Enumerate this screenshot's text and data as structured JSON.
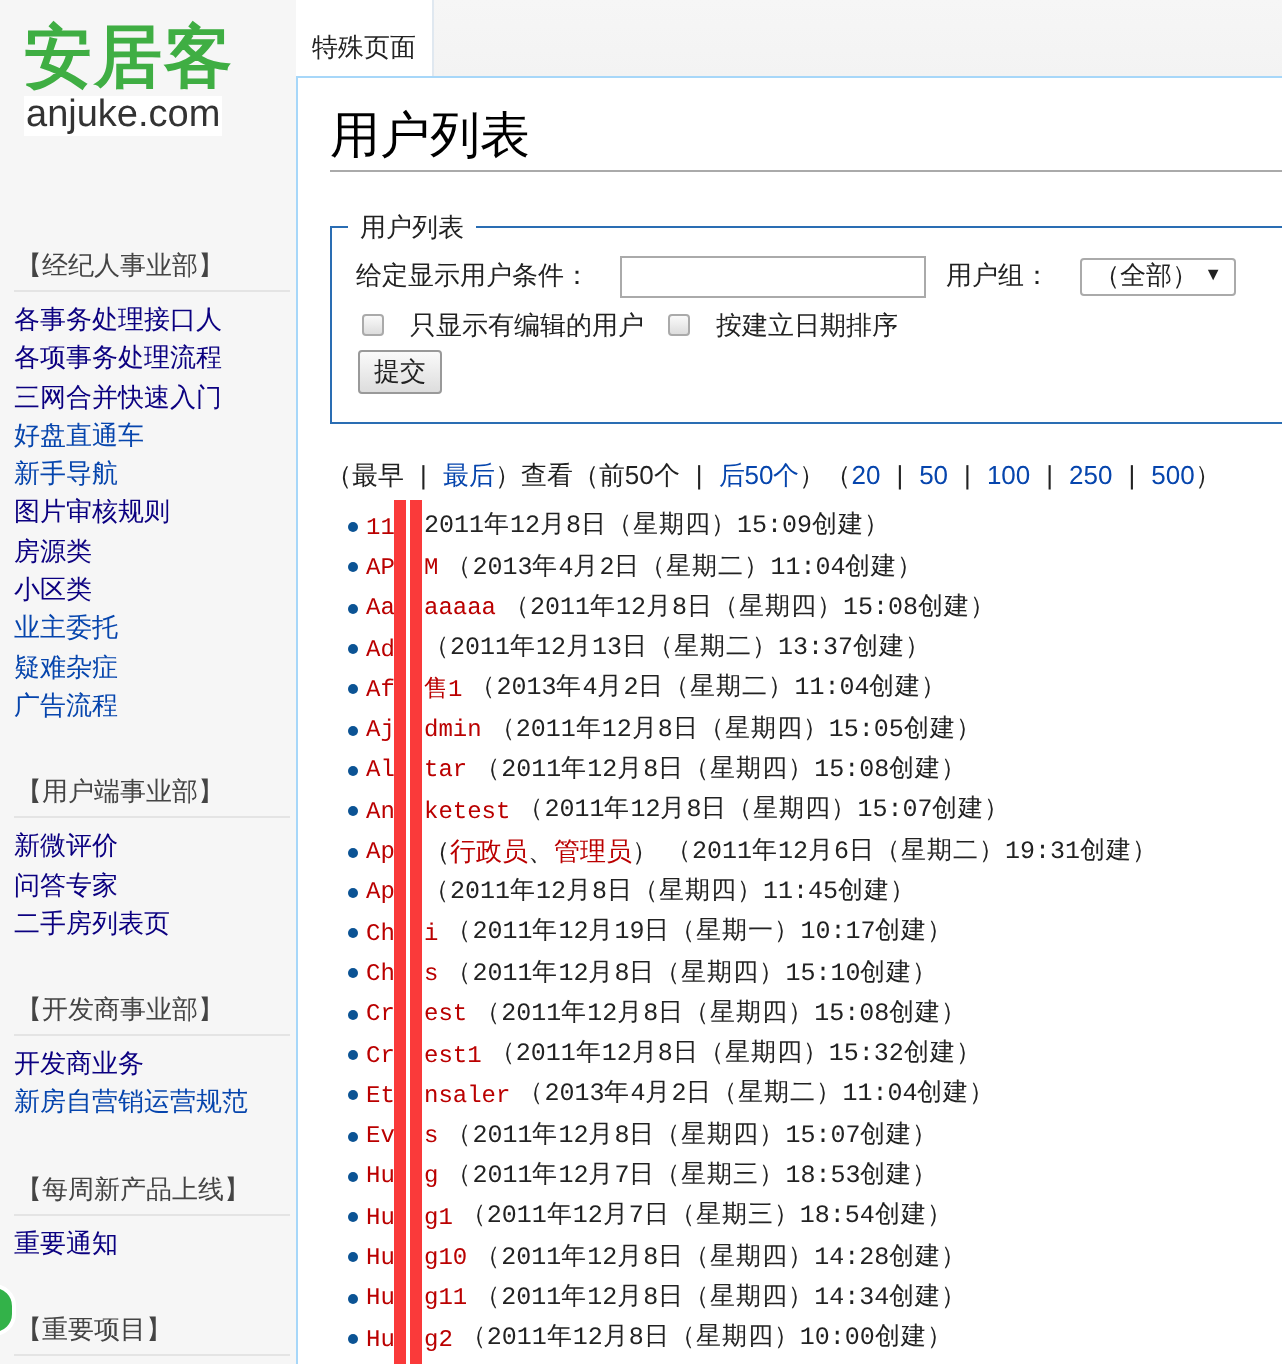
{
  "logo": {
    "title": "安居客",
    "domain": "anjuke.com"
  },
  "sidebar": {
    "sections": [
      {
        "heading": "【经纪人事业部】",
        "items": [
          {
            "label": "各事务处理接口人",
            "visited": true
          },
          {
            "label": "各项事务处理流程",
            "visited": true
          },
          {
            "label": "三网合并快速入门",
            "visited": true
          },
          {
            "label": "好盘直通车",
            "visited": false
          },
          {
            "label": "新手导航",
            "visited": false
          },
          {
            "label": "图片审核规则",
            "visited": true
          },
          {
            "label": "房源类",
            "visited": true
          },
          {
            "label": "小区类",
            "visited": true
          },
          {
            "label": "业主委托",
            "visited": false
          },
          {
            "label": "疑难杂症",
            "visited": false
          },
          {
            "label": "广告流程",
            "visited": false
          }
        ]
      },
      {
        "heading": "【用户端事业部】",
        "items": [
          {
            "label": "新微评价",
            "visited": true
          },
          {
            "label": "问答专家",
            "visited": true
          },
          {
            "label": "二手房列表页",
            "visited": true
          }
        ]
      },
      {
        "heading": "【开发商事业部】",
        "items": [
          {
            "label": "开发商业务",
            "visited": true
          },
          {
            "label": "新房自营销运营规范",
            "visited": false
          }
        ]
      },
      {
        "heading": "【每周新产品上线】",
        "items": [
          {
            "label": "重要通知",
            "visited": true
          }
        ]
      },
      {
        "heading": "【重要项目】"
      }
    ]
  },
  "tabs": [
    {
      "label": "特殊页面",
      "selected": true
    }
  ],
  "title": "用户列表",
  "form": {
    "legend": "用户列表",
    "condition_label": "给定显示用户条件：",
    "group_label": "用户组：",
    "group_value": "（全部）",
    "dropdown_arrow": "▼",
    "checkboxes": [
      {
        "label": "只显示有编辑的用户",
        "checked": false
      },
      {
        "label": "按建立日期排序",
        "checked": false
      }
    ],
    "submit": "提交"
  },
  "pagination": [
    {
      "text": "（最早",
      "kind": "text"
    },
    {
      "text": "|",
      "kind": "sep"
    },
    {
      "text": "最后",
      "kind": "link"
    },
    {
      "text": "）查看（前50个",
      "kind": "text"
    },
    {
      "text": "|",
      "kind": "sep"
    },
    {
      "text": "后50个",
      "kind": "link"
    },
    {
      "text": "）（",
      "kind": "text"
    },
    {
      "text": "20",
      "kind": "link"
    },
    {
      "text": "|",
      "kind": "sep"
    },
    {
      "text": "50",
      "kind": "link"
    },
    {
      "text": "|",
      "kind": "sep"
    },
    {
      "text": "100",
      "kind": "link"
    },
    {
      "text": "|",
      "kind": "sep"
    },
    {
      "text": "250",
      "kind": "link"
    },
    {
      "text": "|",
      "kind": "sep"
    },
    {
      "text": "500",
      "kind": "link"
    },
    {
      "text": "）",
      "kind": "text"
    }
  ],
  "users": [
    {
      "name_start": "11",
      "created": "2011年12月8日（星期四）15:09创建）"
    },
    {
      "name_start": "AP",
      "name_end": "M",
      "created": "（2013年4月2日（星期二）11:04创建）"
    },
    {
      "name_start": "Aa",
      "name_end": "aaaaa",
      "created": "（2011年12月8日（星期四）15:08创建）"
    },
    {
      "name_start": "Ad",
      "created": "（2011年12月13日（星期二）13:37创建）"
    },
    {
      "name_start": "Af",
      "name_end": "售1",
      "created": "（2013年4月2日（星期二）11:04创建）"
    },
    {
      "name_start": "Aj",
      "name_end": "dmin",
      "created": "（2011年12月8日（星期四）15:05创建）"
    },
    {
      "name_start": "Al",
      "name_end": "tar",
      "created": "（2011年12月8日（星期四）15:08创建）"
    },
    {
      "name_start": "An",
      "name_end": "ketest",
      "created": "（2011年12月8日（星期四）15:07创建）"
    },
    {
      "name_start": "Ap",
      "groups": [
        {
          "text": "（",
          "kind": "text"
        },
        {
          "text": "行政员",
          "kind": "link"
        },
        {
          "text": "、",
          "kind": "text"
        },
        {
          "text": "管理员",
          "kind": "link"
        },
        {
          "text": "）",
          "kind": "text"
        }
      ],
      "created": "（2011年12月6日（星期二）19:31创建）"
    },
    {
      "name_start": "Ap",
      "created": "（2011年12月8日（星期四）11:45创建）"
    },
    {
      "name_start": "Ch",
      "name_end": "i",
      "created": "（2011年12月19日（星期一）10:17创建）"
    },
    {
      "name_start": "Ch",
      "name_end": "s",
      "created": "（2011年12月8日（星期四）15:10创建）"
    },
    {
      "name_start": "Cr",
      "name_end": "est",
      "created": "（2011年12月8日（星期四）15:08创建）"
    },
    {
      "name_start": "Cr",
      "name_end": "est1",
      "created": "（2011年12月8日（星期四）15:32创建）"
    },
    {
      "name_start": "Et",
      "name_end": "nsaler",
      "created": "（2013年4月2日（星期二）11:04创建）"
    },
    {
      "name_start": "Ev",
      "name_end": "s",
      "created": "（2011年12月8日（星期四）15:07创建）"
    },
    {
      "name_start": "Hu",
      "name_end": "g",
      "created": "（2011年12月7日（星期三）18:53创建）"
    },
    {
      "name_start": "Hu",
      "name_end": "g1",
      "created": "（2011年12月7日（星期三）18:54创建）"
    },
    {
      "name_start": "Hu",
      "name_end": "g10",
      "created": "（2011年12月8日（星期四）14:28创建）"
    },
    {
      "name_start": "Hu",
      "name_end": "g11",
      "created": "（2011年12月8日（星期四）14:34创建）"
    },
    {
      "name_start": "Hu",
      "name_end": "g2",
      "created": "（2011年12月8日（星期四）10:00创建）"
    }
  ]
}
